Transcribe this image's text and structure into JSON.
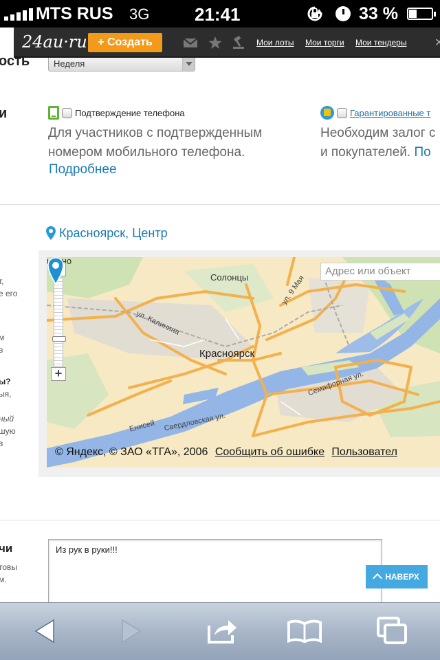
{
  "status_bar": {
    "carrier": "MTS RUS",
    "network": "3G",
    "time": "21:41",
    "battery": "33 %",
    "battery_level": 0.33
  },
  "site_header": {
    "logo": "24au·ru",
    "create_button": "+ Создать",
    "links": [
      "Мои лоты",
      "Мои торги",
      "Мои тендеры"
    ]
  },
  "left_fragments": {
    "row1": "ость",
    "row2": "и",
    "f1": "т,",
    "f2": "е его",
    "f3": "м",
    "f4": "в",
    "f5": "ы?",
    "f6": "ыя,",
    "f7": "ный",
    "f8": "шую",
    "f9": "в",
    "f10": "чи",
    "f11": "товы",
    "f12": "м."
  },
  "period_select": {
    "value": "Неделя"
  },
  "options": {
    "phone": {
      "label": "Подтверждение телефона",
      "desc_line1": "Для участников с подтвержденным",
      "desc_line2": "номером мобильного телефона.",
      "more": "Подробнее"
    },
    "guaranteed": {
      "label": "Гарантированные т",
      "desc_line1": "Необходим залог с",
      "desc_line2": "и покупателей.",
      "more": "По"
    }
  },
  "location": {
    "text": "Красноярск, Центр"
  },
  "map": {
    "search_placeholder": "Адрес или объект",
    "labels": {
      "city": "Красноярск",
      "solontsy": "Солонцы",
      "ininsko": "инино",
      "street_9maya": "ул. 9 Мая",
      "street_kalinina": "ул. Калинина",
      "street_semafornaya": "Семафорная ул.",
      "street_sverdlovskaya": "Свердловская ул.",
      "enisey": "Енисей"
    },
    "copyright": "© Яндекс, © ЗАО «ТГА», 2006",
    "report_link": "Сообщить об ошибке",
    "terms_link": "Пользовател"
  },
  "description_text": "Из рук в руки!!!",
  "up_button": "НАВЕРХ",
  "icons": {
    "mail": "mail-icon",
    "star": "star-icon",
    "gavel": "gavel-icon",
    "back": "back-arrow-icon",
    "forward": "forward-arrow-icon",
    "share": "share-icon",
    "bookmarks": "bookmarks-icon",
    "tabs": "tabs-icon"
  },
  "colors": {
    "accent_orange": "#f39a1a",
    "link_blue": "#1a7ab3",
    "up_button": "#44a9e0"
  }
}
